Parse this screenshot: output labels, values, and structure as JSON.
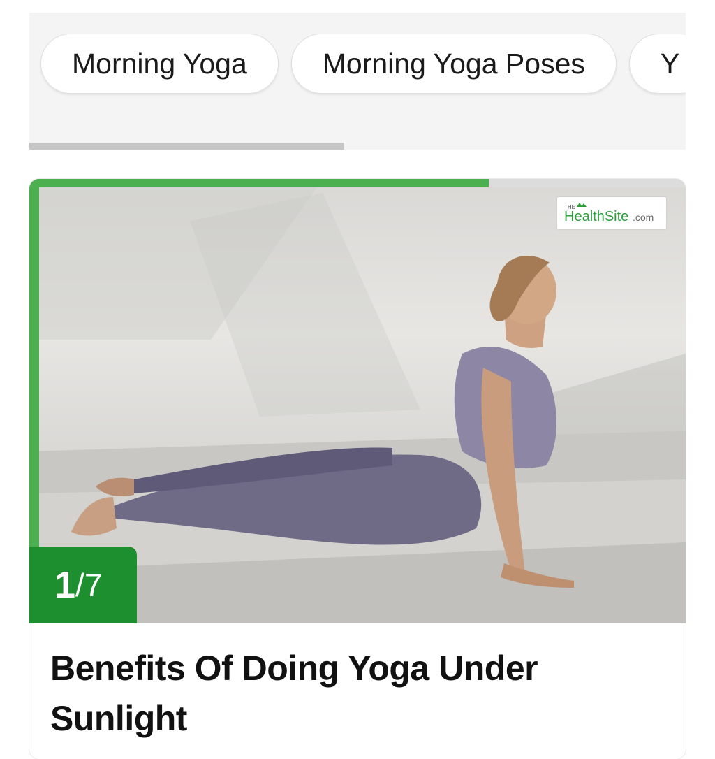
{
  "chips": [
    {
      "label": "Morning Yoga"
    },
    {
      "label": "Morning Yoga Poses"
    },
    {
      "label": "Y"
    }
  ],
  "chips_scroll_fraction": 0.48,
  "story": {
    "progress_fraction": 0.7,
    "counter_current": "1",
    "counter_separator": "/",
    "counter_total": "7",
    "title": "Benefits Of Doing Yoga Under Sunlight",
    "watermark_small": "THE",
    "watermark_main": "HealthSite",
    "watermark_suffix": ".com"
  },
  "colors": {
    "accent_green": "#4caf50",
    "counter_green": "#1e8f2e"
  },
  "icons": {
    "watermark": "healthsite-logo-icon"
  }
}
